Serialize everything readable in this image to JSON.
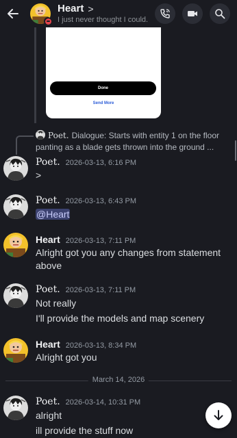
{
  "header": {
    "name": "Heart",
    "chevron": ">",
    "status": "I just never thought I could..."
  },
  "embed": {
    "done_label": "Done",
    "send_more_label": "Send More"
  },
  "reply": {
    "author": "Poet.",
    "text": "Dialogue:  Starts with entity 1 on the floor panting as a blade gets thrown into the ground ..."
  },
  "messages": [
    {
      "author": "Poet.",
      "time": "2026-03-13, 6:16 PM",
      "lines": [
        ">"
      ]
    },
    {
      "author": "Poet.",
      "time": "2026-03-13, 6:43 PM",
      "lines": [
        "@Heart"
      ]
    },
    {
      "author": "Heart",
      "time": "2026-03-13, 7:11 PM",
      "lines": [
        "Alright got you any changes from statement",
        "above"
      ]
    },
    {
      "author": "Poet.",
      "time": "2026-03-13, 7:11 PM",
      "lines": [
        "Not really",
        "I'll provide the models and map scenery"
      ]
    },
    {
      "author": "Heart",
      "time": "2026-03-13, 8:34 PM",
      "lines": [
        "Alright got you"
      ]
    },
    {
      "author": "Poet.",
      "time": "2026-03-14, 10:31 PM",
      "lines": [
        "alright",
        "ill provide the stuff now"
      ]
    }
  ],
  "date_divider": "March 14, 2026",
  "colors": {
    "background": "#1a1b21",
    "mention_bg": "#3c4270",
    "dnd_status": "#e3434b",
    "send_more_link": "#2a5bd7"
  }
}
